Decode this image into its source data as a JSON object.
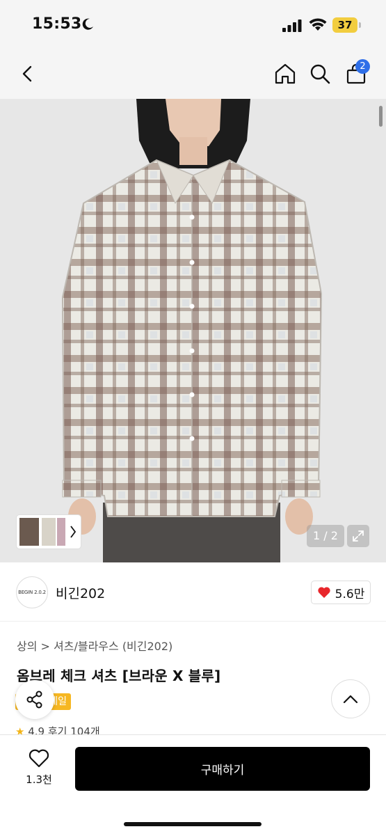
{
  "status_bar": {
    "time": "15:53",
    "battery": "37"
  },
  "nav": {
    "cart_count": "2"
  },
  "gallery": {
    "counter": "1 / 2"
  },
  "brand": {
    "logo_text": "BEGIN 2.0.2",
    "name": "비긴202",
    "likes": "5.6만"
  },
  "product": {
    "breadcrumb": "상의 > 셔츠/블라우스 (비긴202)",
    "title": "옴브레 체크 셔츠 [브라운 X 블루]",
    "promo_badge": "세일",
    "rating_line": "4.9 후기 104개"
  },
  "bottom": {
    "wish_count": "1.3천",
    "buy_label": "구매하기"
  },
  "colors": {
    "accent_badge": "#2f6fe8",
    "heart": "#e8262b",
    "promo": "#f6b722"
  },
  "icons": [
    "back-arrow-icon",
    "home-icon",
    "search-icon",
    "bag-icon",
    "moon-icon",
    "signal-icon",
    "wifi-icon",
    "expand-icon",
    "heart-icon",
    "share-icon",
    "chevron-up-icon",
    "star-icon"
  ]
}
